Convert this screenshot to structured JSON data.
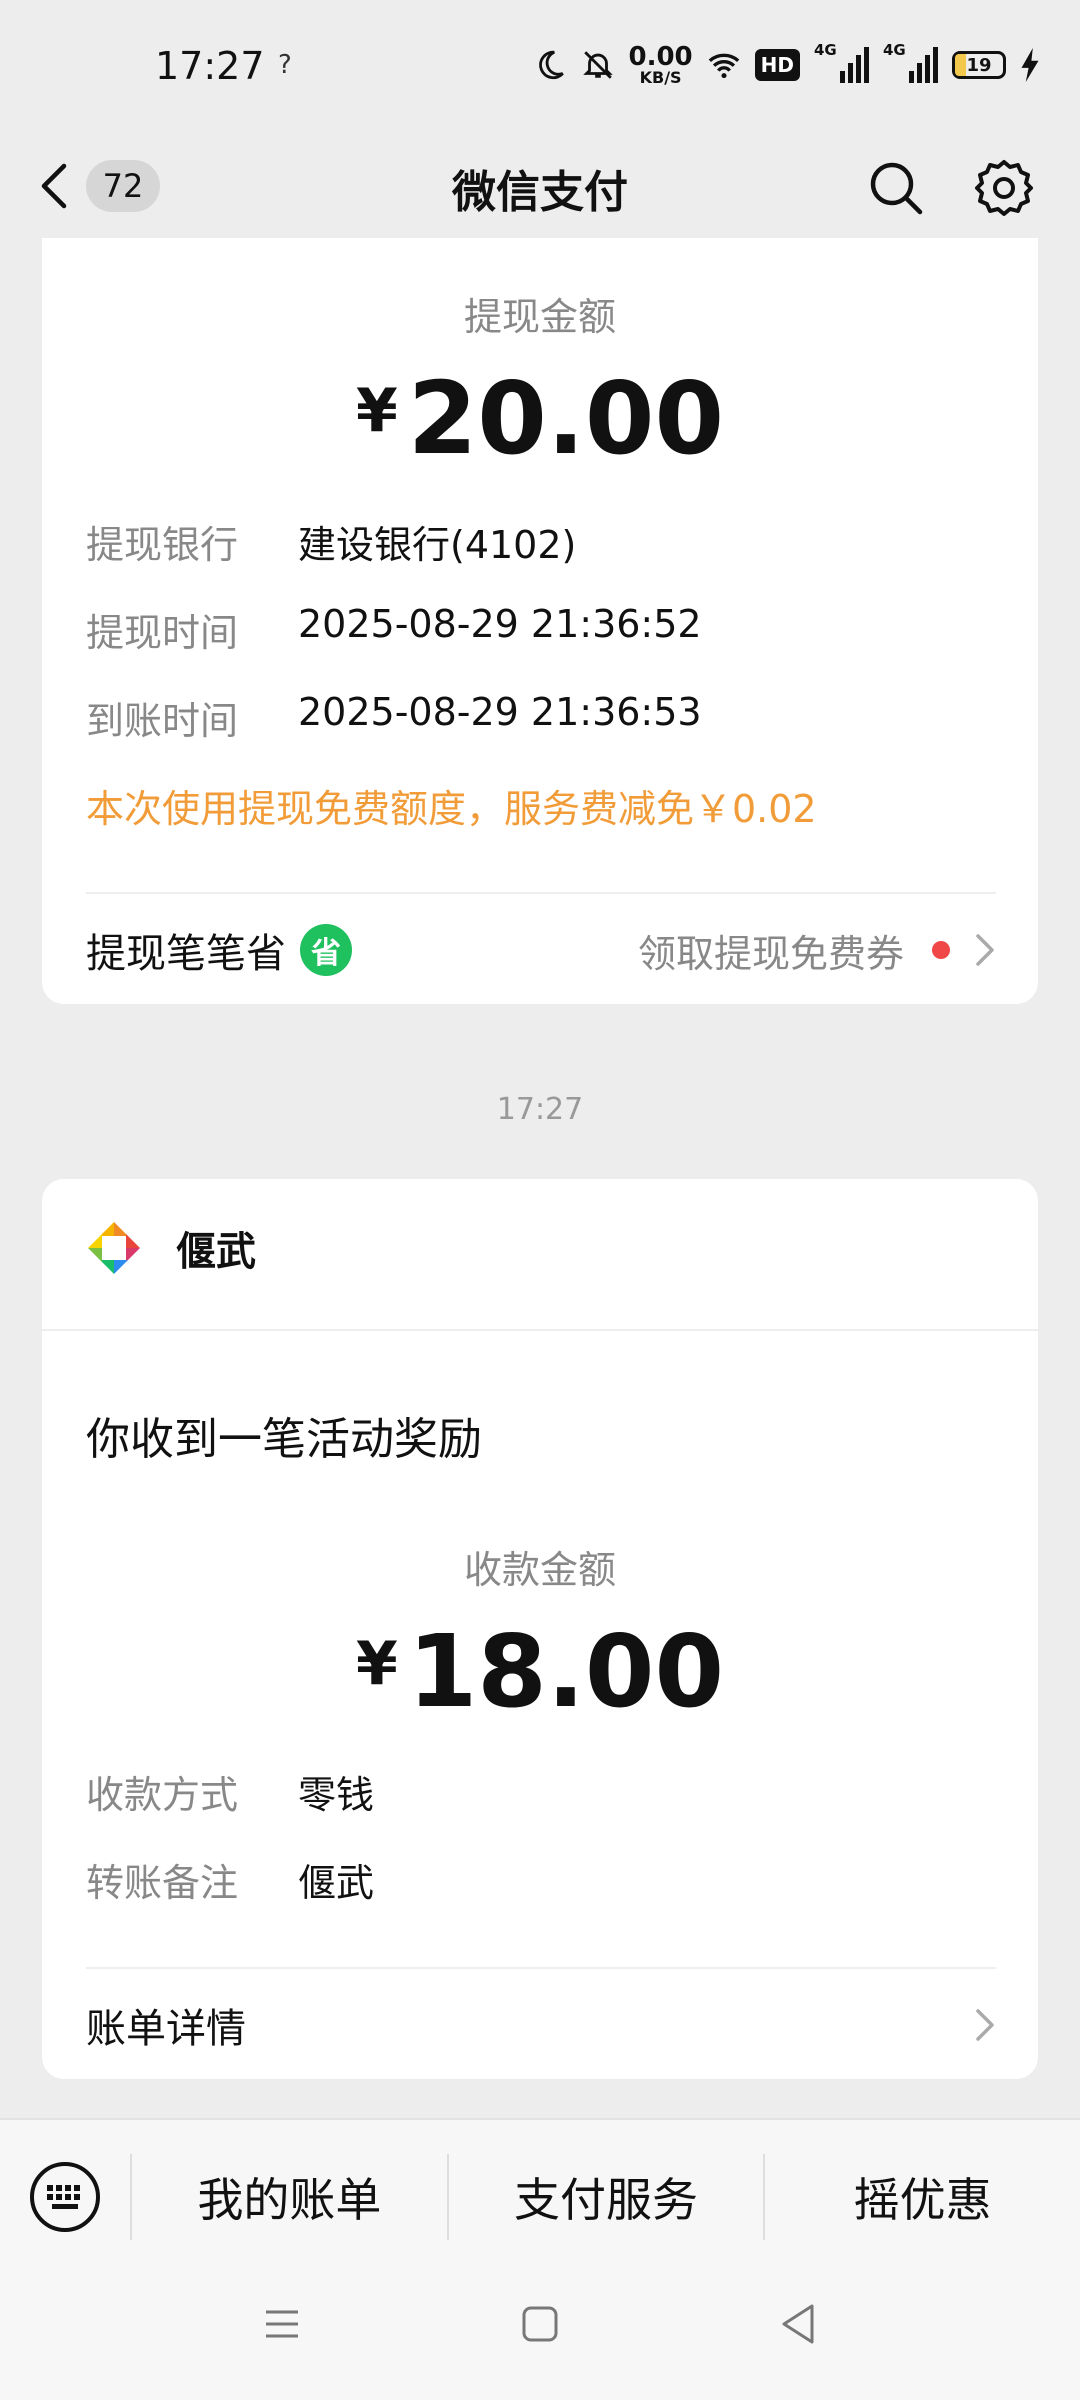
{
  "status_bar": {
    "time": "17:27",
    "signal_hint": "?",
    "net_speed": "0.00",
    "net_unit": "KB/S",
    "hd_label": "HD",
    "sim1_label": "4G",
    "sim2_label": "4G",
    "battery": "19"
  },
  "header": {
    "unread_count": "72",
    "title": "微信支付"
  },
  "withdraw_card": {
    "amount_label": "提现金额",
    "currency": "¥",
    "amount": "20.00",
    "rows": [
      {
        "key": "提现银行",
        "value": "建设银行(4102)"
      },
      {
        "key": "提现时间",
        "value": "2025-08-29 21:36:52"
      },
      {
        "key": "到账时间",
        "value": "2025-08-29 21:36:53"
      }
    ],
    "promo_text": "本次使用提现免费额度，服务费减免￥0.02",
    "footer_left": "提现笔笔省",
    "footer_badge": "省",
    "footer_right": "领取提现免费券",
    "accent_color": "#f19c38"
  },
  "timestamp": "17:27",
  "reward_card": {
    "merchant": "偃武",
    "title": "你收到一笔活动奖励",
    "amount_label": "收款金额",
    "currency": "¥",
    "amount": "18.00",
    "rows": [
      {
        "key": "收款方式",
        "value": "零钱"
      },
      {
        "key": "转账备注",
        "value": "偃武"
      }
    ],
    "footer_left": "账单详情"
  },
  "bottom_menu": {
    "tabs": [
      "我的账单",
      "支付服务",
      "摇优惠"
    ]
  },
  "icons": [
    "back-icon",
    "search-icon",
    "gear-icon",
    "chevron-right-icon",
    "keyboard-icon",
    "merchant-logo-icon",
    "nav-menu-icon",
    "nav-home-icon",
    "nav-back-icon"
  ]
}
